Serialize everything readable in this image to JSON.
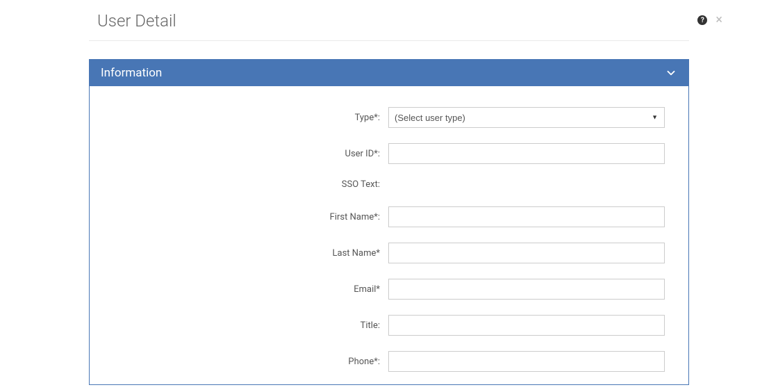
{
  "header": {
    "title": "User Detail"
  },
  "panel": {
    "title": "Information"
  },
  "form": {
    "type": {
      "label": "Type*:",
      "placeholder": "(Select user type)",
      "value": ""
    },
    "user_id": {
      "label": "User ID*:",
      "value": ""
    },
    "sso_text": {
      "label": "SSO Text:",
      "value": ""
    },
    "first_name": {
      "label": "First Name*:",
      "value": ""
    },
    "last_name": {
      "label": "Last Name*",
      "value": ""
    },
    "email": {
      "label": "Email*",
      "value": ""
    },
    "title": {
      "label": "Title:",
      "value": ""
    },
    "phone": {
      "label": "Phone*:",
      "value": ""
    }
  }
}
